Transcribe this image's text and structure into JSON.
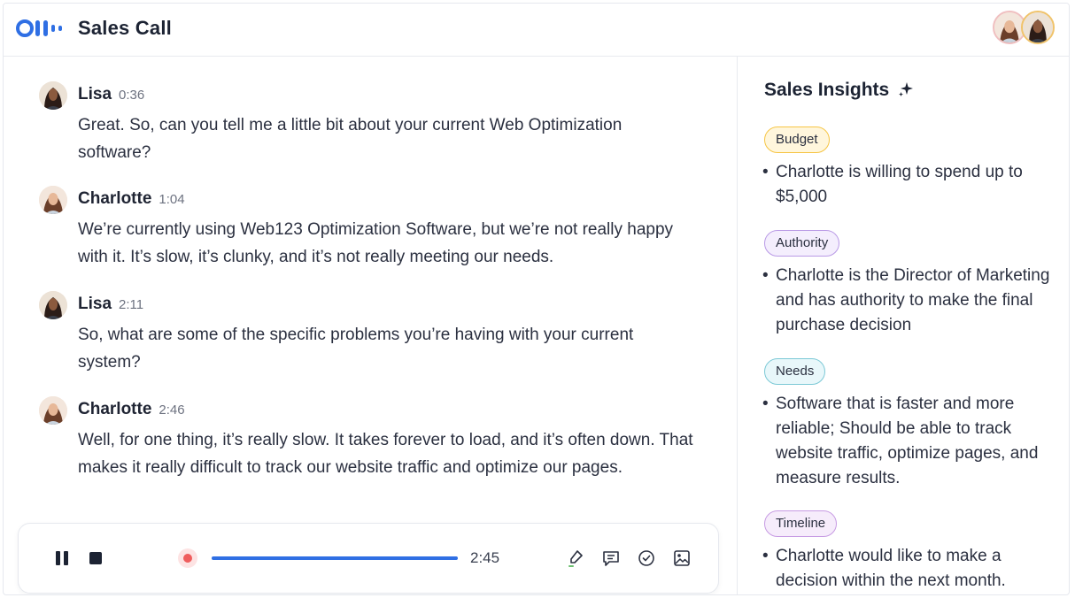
{
  "app": {
    "title": "Sales Call",
    "logo_icon": "otter-logo-icon",
    "accent_color": "#2f6fe4"
  },
  "participants": [
    "Lisa",
    "Charlotte"
  ],
  "transcript": [
    {
      "speaker": "Lisa",
      "time": "0:36",
      "text": "Great. So, can you tell me a little bit about your current Web Optimization software?"
    },
    {
      "speaker": "Charlotte",
      "time": "1:04",
      "text": "We’re currently using Web123 Optimization Software, but we’re not really happy with it. It’s slow, it’s clunky, and it’s not really meeting our needs."
    },
    {
      "speaker": "Lisa",
      "time": "2:11",
      "text": "So, what are some of the specific problems you’re having with your current system?"
    },
    {
      "speaker": "Charlotte",
      "time": "2:46",
      "text": "Well, for one thing, it’s really slow. It takes forever to load, and it’s often down. That makes it really difficult to track our website traffic and optimize our pages."
    }
  ],
  "player": {
    "time": "2:45",
    "progress": 1.0,
    "icons": [
      "pause-icon",
      "stop-icon",
      "record-icon",
      "highlight-icon",
      "comment-icon",
      "check-icon",
      "image-icon"
    ]
  },
  "insights": {
    "title": "Sales Insights",
    "sections": [
      {
        "tag": "Budget",
        "color": "#f6c544",
        "bg": "#fff6dc",
        "bullet": "Charlotte is willing to spend up to $5,000"
      },
      {
        "tag": "Authority",
        "color": "#b99ae6",
        "bg": "#f4eefd",
        "bullet": "Charlotte is the Director of Marketing and has authority to make the final purchase decision"
      },
      {
        "tag": "Needs",
        "color": "#7cc9d6",
        "bg": "#e8f7fa",
        "bullet": "Software that is faster and more reliable; Should be able to track website traffic, optimize pages, and measure results."
      },
      {
        "tag": "Timeline",
        "color": "#c79be3",
        "bg": "#f6ecfb",
        "bullet": "Charlotte would like to make a decision within the next month."
      }
    ]
  }
}
